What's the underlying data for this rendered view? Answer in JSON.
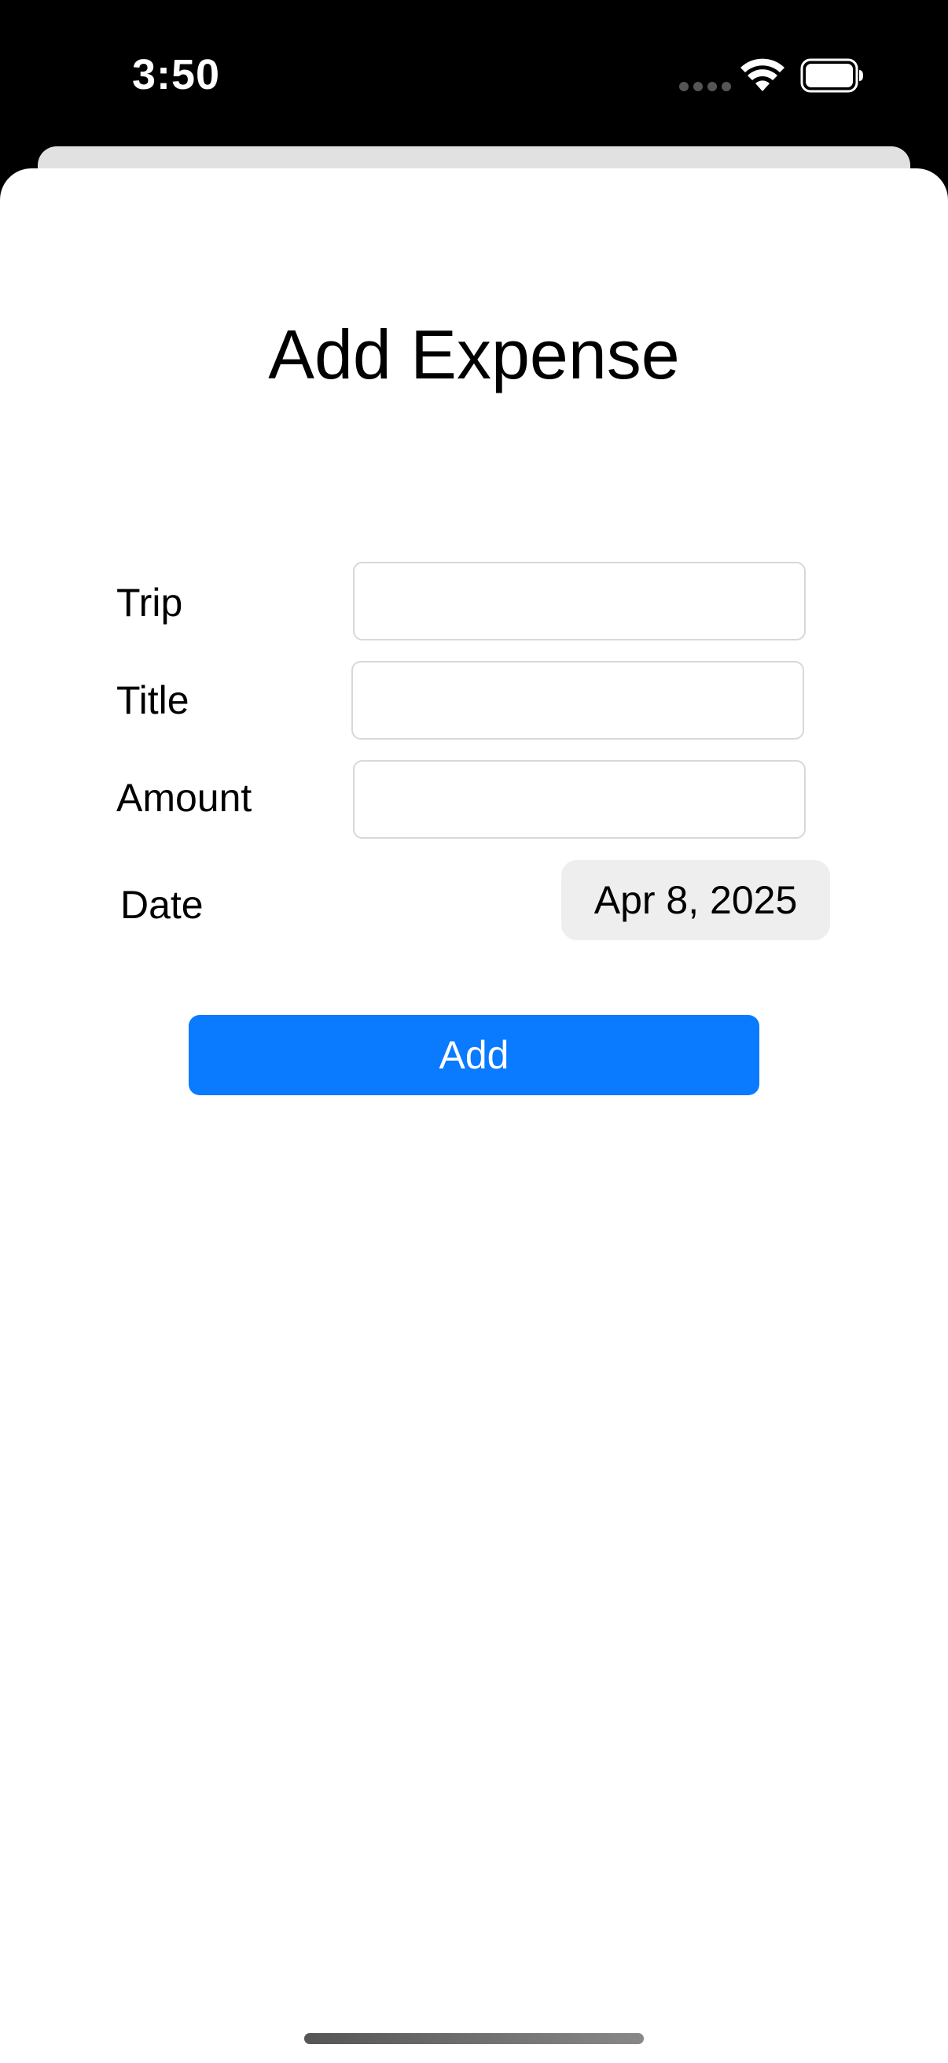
{
  "status_bar": {
    "time": "3:50",
    "icons": [
      "signal-dots-icon",
      "wifi-icon",
      "battery-icon"
    ]
  },
  "page": {
    "title": "Add Expense"
  },
  "form": {
    "trip": {
      "label": "Trip",
      "value": "",
      "placeholder": ""
    },
    "title": {
      "label": "Title",
      "value": "",
      "placeholder": ""
    },
    "amount": {
      "label": "Amount",
      "value": "",
      "placeholder": ""
    },
    "date": {
      "label": "Date",
      "value": "Apr 8, 2025"
    }
  },
  "actions": {
    "add_label": "Add"
  },
  "colors": {
    "accent": "#0a7aff",
    "date_chip_bg": "#eeeeee",
    "input_border": "#d8d8d8"
  }
}
